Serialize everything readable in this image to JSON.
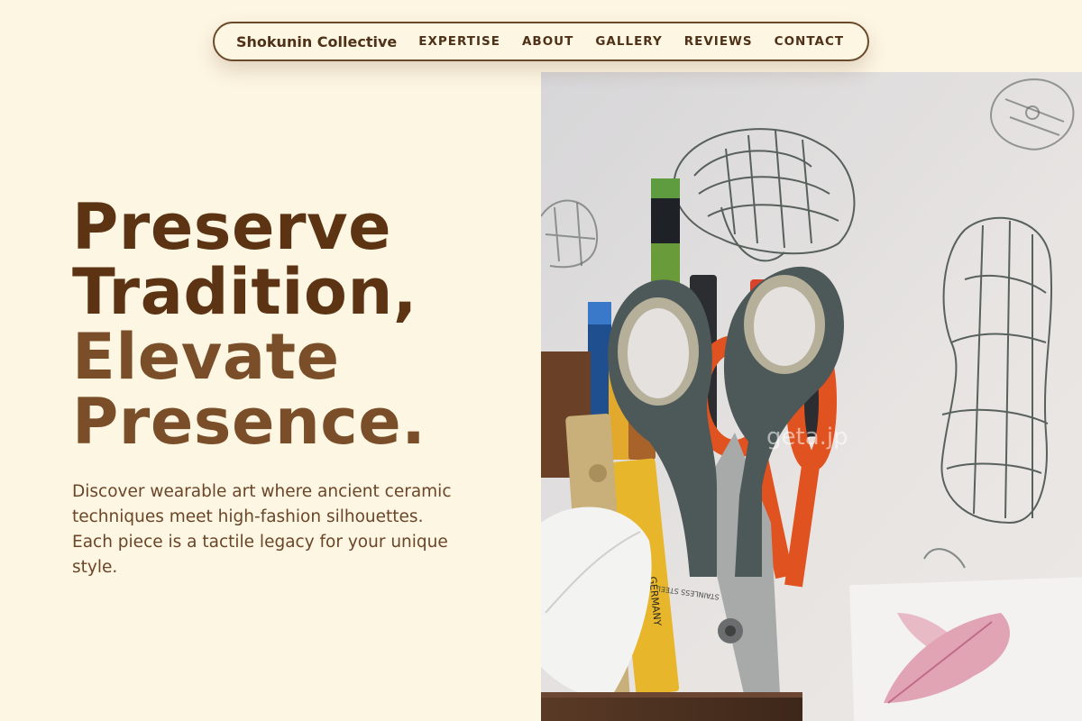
{
  "nav": {
    "brand": "Shokunin Collective",
    "links": [
      "EXPERTISE",
      "ABOUT",
      "GALLERY",
      "REVIEWS",
      "CONTACT"
    ]
  },
  "hero": {
    "headline_line1": "Preserve",
    "headline_line2": "Tradition,",
    "headline_line3": "Elevate",
    "headline_line4": "Presence.",
    "description": "Discover wearable art where ancient ceramic techniques meet high-fashion silhouettes. Each piece is a tactile legacy for your unique style.",
    "image": {
      "subject": "scissors-pencil-cup-photo",
      "watermark": "geta.jp",
      "scissors_label": "STAINLESS STEEL",
      "pencil_label": "GERMANY"
    }
  },
  "colors": {
    "background": "#fdf6e3",
    "headline_dark": "#5c3414",
    "headline_light": "#7a4e28",
    "body_text": "#6b4528",
    "nav_border": "#6b4a2b"
  }
}
